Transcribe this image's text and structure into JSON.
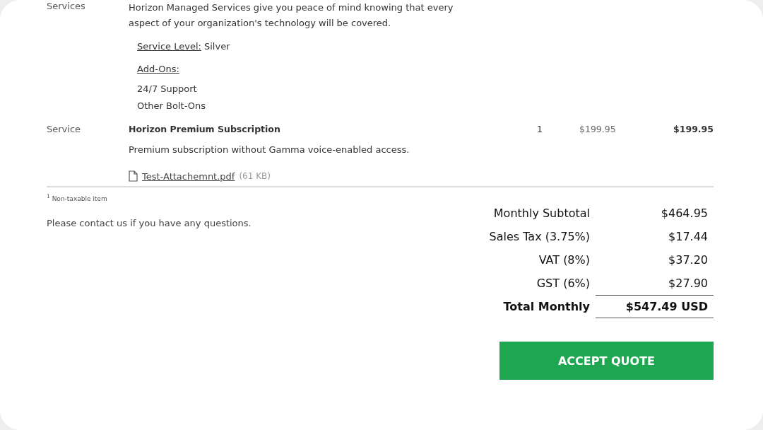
{
  "line_items": [
    {
      "type": "Services",
      "description": "Horizon Managed Services give you peace of mind knowing that every aspect of your organization's technology will be covered.",
      "service_level_label": "Service Level:",
      "service_level": "Silver",
      "addons_label": "Add-Ons:",
      "addons": [
        "24/7 Support",
        "Other Bolt-Ons"
      ]
    },
    {
      "type": "Service",
      "title": "Horizon Premium Subscription",
      "quantity": "1",
      "unit_price": "$199.95",
      "total": "$199.95",
      "description": "Premium subscription without Gamma voice-enabled access.",
      "attachment": {
        "name": "Test-Attachemnt.pdf",
        "size": "(61 KB)"
      }
    }
  ],
  "footnote": "$^{1}$ Non-taxable item",
  "contact_note": "Please contact us if you have any questions.",
  "totals": [
    {
      "label": "Monthly Subtotal",
      "value": "$464.95",
      "kind": "line"
    },
    {
      "label": "Sales Tax (3.75%)",
      "value": "$17.44",
      "kind": "line"
    },
    {
      "label": "VAT (8%)",
      "value": "$37.20",
      "kind": "line"
    },
    {
      "label": "GST (6%)",
      "value": "$27.90",
      "kind": "line"
    },
    {
      "label": "Total Monthly",
      "value": "$547.49 USD",
      "kind": "total"
    }
  ],
  "accept_button": "ACCEPT QUOTE"
}
